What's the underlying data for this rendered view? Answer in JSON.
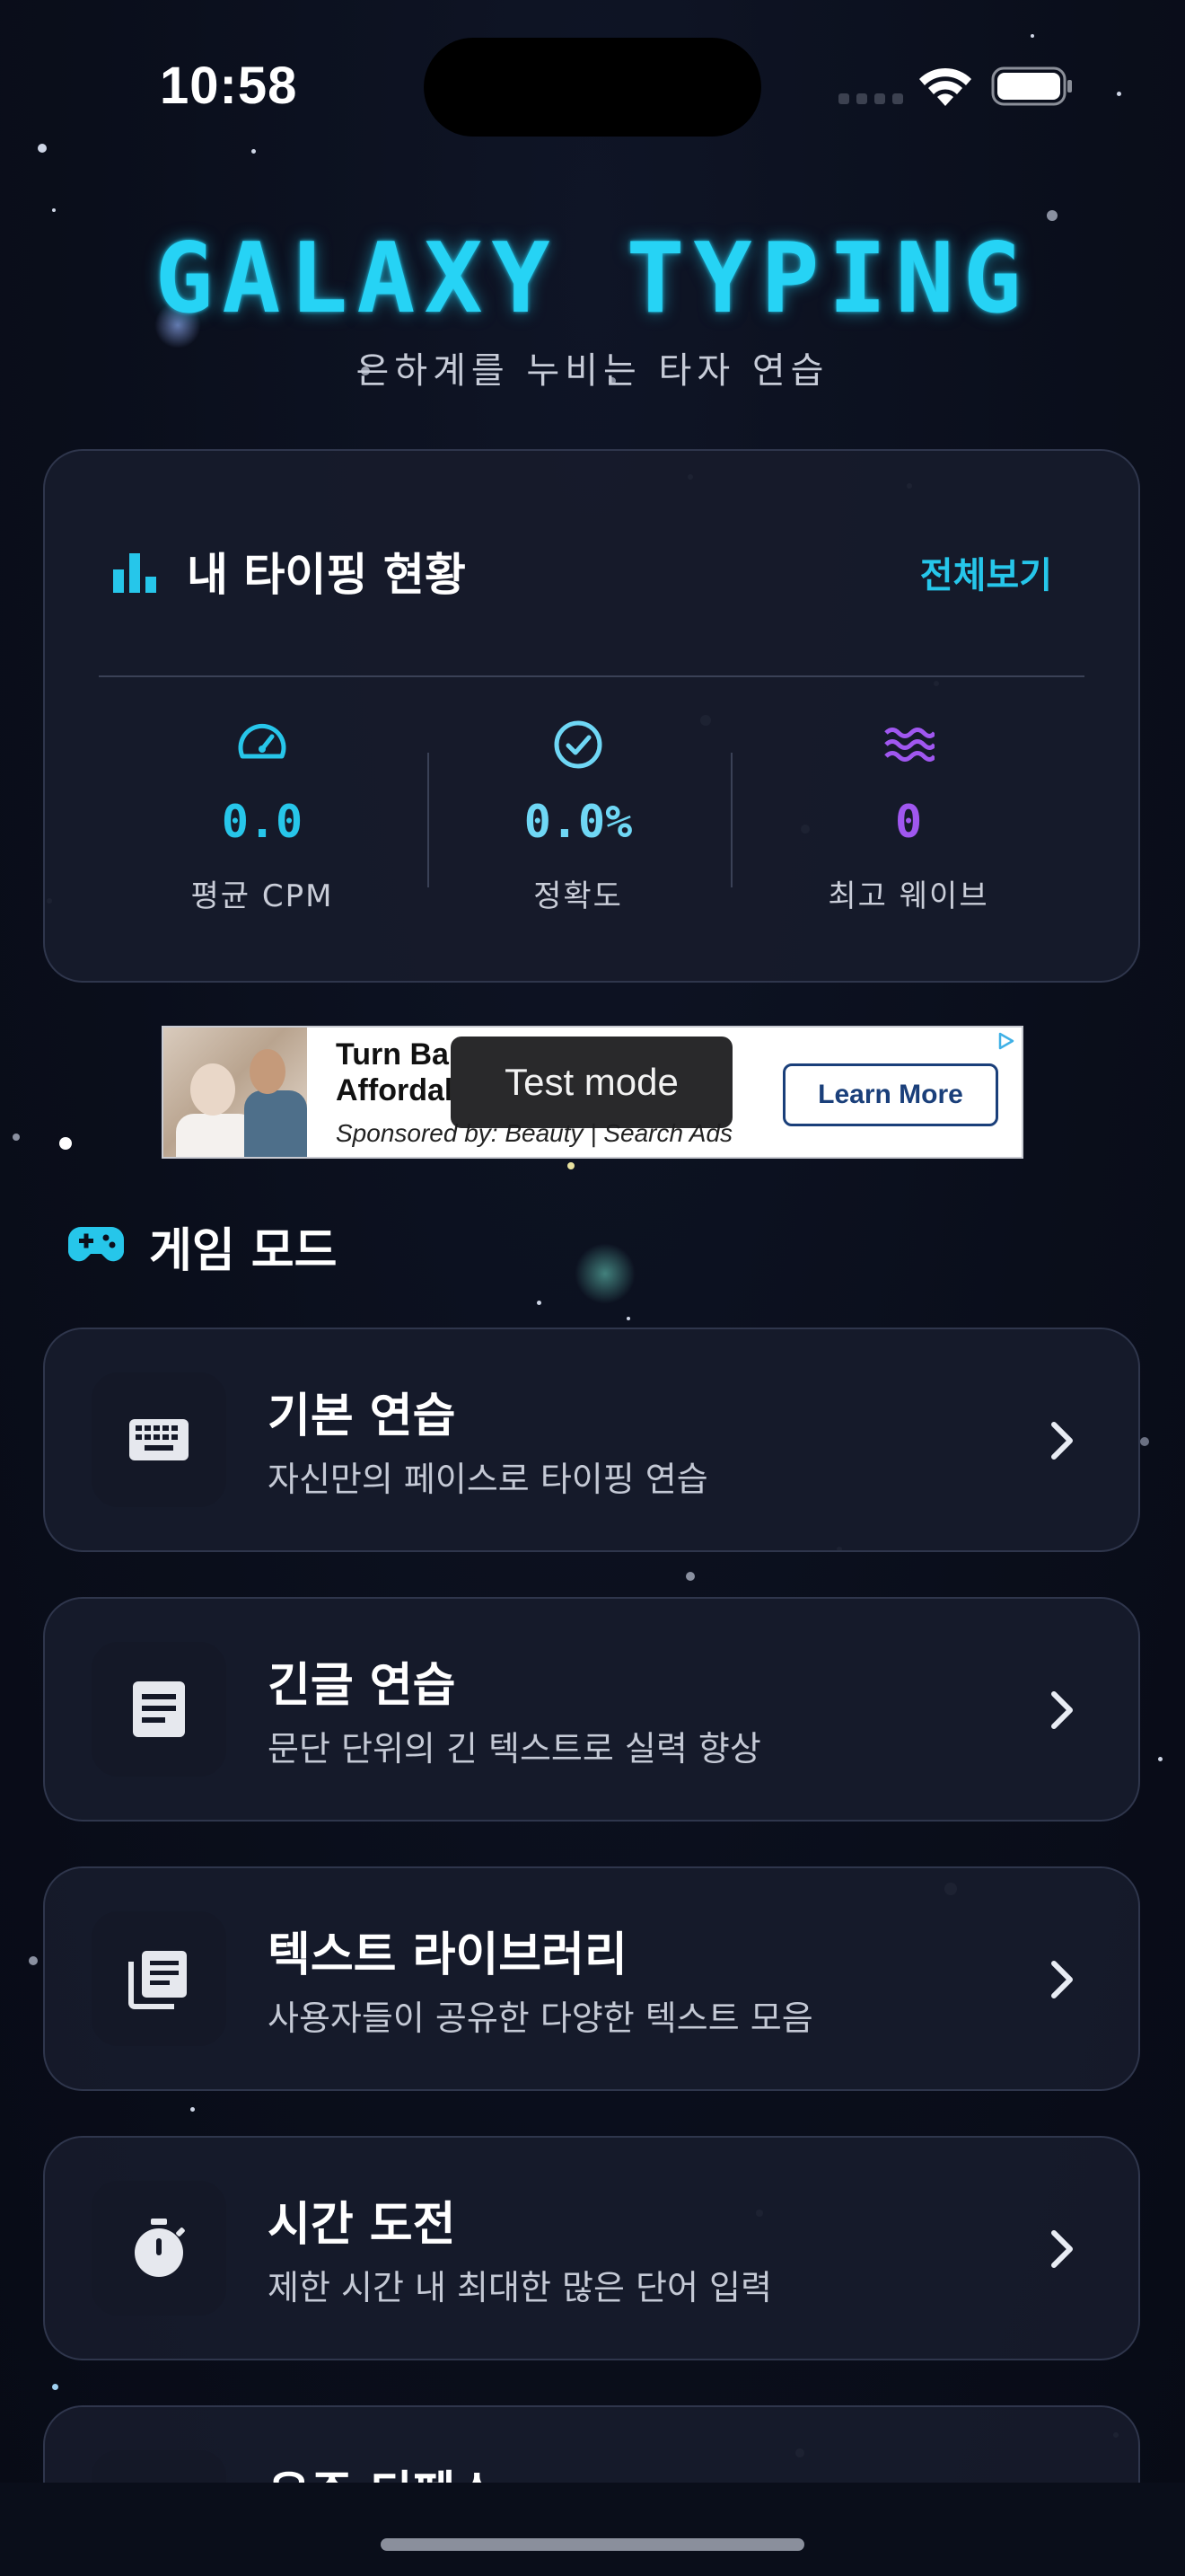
{
  "status_bar": {
    "time": "10:58"
  },
  "header": {
    "title": "GALAXY TYPING",
    "subtitle": "은하계를 누비는 타자 연습"
  },
  "stats": {
    "title": "내 타이핑 현황",
    "view_all": "전체보기",
    "items": [
      {
        "value": "0.0",
        "label": "평균 CPM",
        "icon": "speedometer-icon",
        "color": "#27c6ea"
      },
      {
        "value": "0.0%",
        "label": "정확도",
        "icon": "check-circle-icon",
        "color": "#6fd7f5"
      },
      {
        "value": "0",
        "label": "최고 웨이브",
        "icon": "waves-icon",
        "color": "#a057f0"
      }
    ]
  },
  "ad": {
    "headline": "Turn Ba\nAffordal",
    "sponsor": "Sponsored by: Beauty | Search Ads",
    "cta": "Learn More",
    "toast": "Test mode"
  },
  "game_modes": {
    "section_title": "게임 모드",
    "items": [
      {
        "title": "기본 연습",
        "description": "자신만의 페이스로 타이핑 연습",
        "icon": "keyboard-icon"
      },
      {
        "title": "긴글 연습",
        "description": "문단 단위의 긴 텍스트로 실력 향상",
        "icon": "document-icon"
      },
      {
        "title": "텍스트 라이브러리",
        "description": "사용자들이 공유한 다양한 텍스트 모음",
        "icon": "library-icon"
      },
      {
        "title": "시간 도전",
        "description": "제한 시간 내 최대한 많은 단어 입력",
        "icon": "stopwatch-icon"
      },
      {
        "title": "우주 디펜스",
        "description": "",
        "icon": "rocket-icon"
      }
    ]
  },
  "colors": {
    "accent_cyan": "#26d3f5",
    "accent_purple": "#a057f0",
    "background": "#0b0f1c",
    "card": "#171b2b"
  }
}
